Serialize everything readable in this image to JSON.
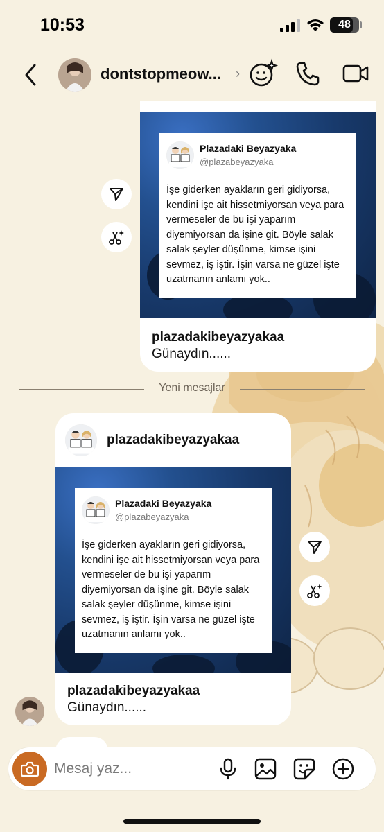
{
  "status_bar": {
    "time": "10:53",
    "battery": "48"
  },
  "header": {
    "contact_name": "dontstopmeow...",
    "chevron": "›"
  },
  "messages": [
    {
      "tweet": {
        "name": "Plazadaki Beyazyaka",
        "handle": "@plazabeyazyaka",
        "text": "İşe giderken ayakların geri gidiyorsa, kendini işe ait hissetmiyorsan veya para vermeseler de bu işi yaparım diyemiyorsan da işine git. Böyle salak salak şeyler düşünme, kimse işini sevmez, iş iştir. İşin varsa ne güzel işte uzatmanın anlamı yok.."
      },
      "post_username": "plazadakibeyazyakaa",
      "caption": "Günaydın......"
    },
    {
      "header_username": "plazadakibeyazyakaa",
      "tweet": {
        "name": "Plazadaki Beyazyaka",
        "handle": "@plazabeyazyaka",
        "text": "İşe giderken ayakların geri gidiyorsa, kendini işe ait hissetmiyorsan veya para vermeseler de bu işi yaparım diyemiyorsan da işine git. Böyle salak salak şeyler düşünme, kimse işini sevmez, iş iştir. İşin varsa ne güzel işte uzatmanın anlamı yok.."
      },
      "post_username": "plazadakibeyazyakaa",
      "caption": "Günaydın......"
    }
  ],
  "divider": {
    "label": "Yeni mesajlar"
  },
  "composer": {
    "placeholder": "Mesaj yaz..."
  },
  "icons": {
    "back": "chevron-left-icon",
    "effects": "emoji-sparkle-icon",
    "call": "phone-icon",
    "video": "video-camera-icon",
    "share": "send-icon",
    "remix": "scissors-sparkle-icon",
    "camera": "camera-icon",
    "mic": "microphone-icon",
    "gallery": "image-icon",
    "sticker": "sticker-icon",
    "add": "plus-circle-icon"
  },
  "colors": {
    "background": "#f7f1e1",
    "camera_accent": "#c96a23",
    "post_blue": "#23508f"
  }
}
